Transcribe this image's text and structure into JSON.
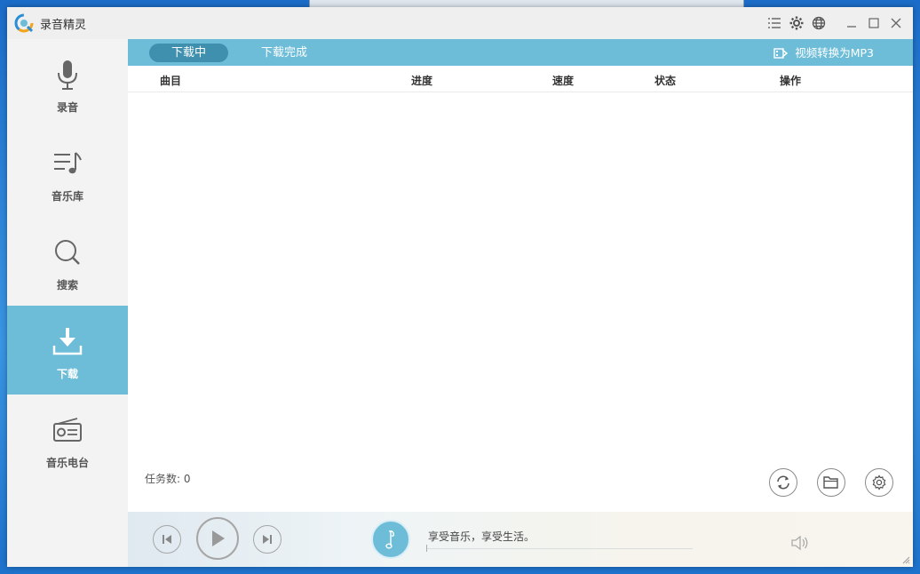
{
  "app": {
    "title": "录音精灵"
  },
  "titlebar": {
    "icons": [
      "menu-icon",
      "settings-icon",
      "globe-icon",
      "minimize-icon",
      "maximize-icon",
      "close-icon"
    ]
  },
  "sidebar": {
    "items": [
      {
        "label": "录音",
        "icon": "microphone-icon",
        "active": false
      },
      {
        "label": "音乐库",
        "icon": "music-library-icon",
        "active": false
      },
      {
        "label": "搜索",
        "icon": "search-icon",
        "active": false
      },
      {
        "label": "下载",
        "icon": "download-icon",
        "active": true
      },
      {
        "label": "音乐电台",
        "icon": "radio-icon",
        "active": false
      }
    ]
  },
  "tabs": {
    "downloading": "下载中",
    "completed": "下载完成",
    "convert": "视频转换为MP3"
  },
  "table": {
    "columns": [
      "曲目",
      "进度",
      "速度",
      "状态",
      "操作"
    ],
    "rows": []
  },
  "footer": {
    "task_count": "任务数: 0",
    "buttons": [
      "refresh-icon",
      "folder-icon",
      "gear-icon"
    ]
  },
  "player": {
    "tagline": "享受音乐，享受生活。"
  },
  "colors": {
    "accent": "#6ebdd8",
    "active_tab": "#3f8fae",
    "sidebar_bg": "#f3f3f3"
  }
}
